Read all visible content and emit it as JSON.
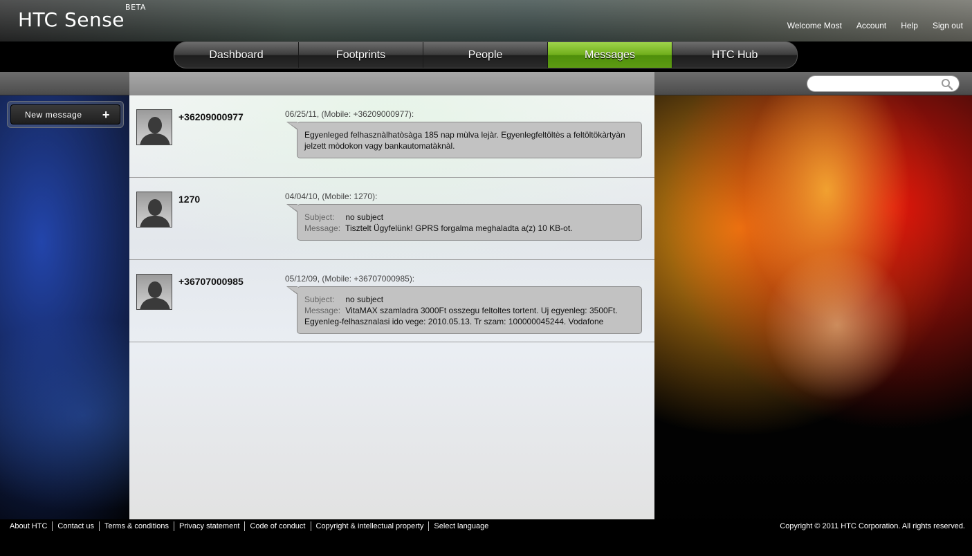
{
  "header": {
    "logo": "HTC Sense",
    "logo_sup": "BETA",
    "links": [
      "Welcome Most",
      "Account",
      "Help",
      "Sign out"
    ]
  },
  "nav": {
    "tabs": [
      {
        "label": "Dashboard",
        "active": false
      },
      {
        "label": "Footprints",
        "active": false
      },
      {
        "label": "People",
        "active": false
      },
      {
        "label": "Messages",
        "active": true
      },
      {
        "label": "HTC Hub",
        "active": false
      }
    ]
  },
  "search": {
    "placeholder": ""
  },
  "sidebar": {
    "new_message_label": "New message",
    "plus": "+"
  },
  "messages": [
    {
      "sender": "+36209000977",
      "meta": "06/25/11, (Mobile: +36209000977):",
      "body": "Egyenleged felhasznàlhatòsàga 185 nap mùlva lejàr. Egyenlegfeltöltès a feltöltökàrtyàn jelzett mòdokon vagy bankautomatàknàl."
    },
    {
      "sender": "1270",
      "meta": "04/04/10, (Mobile: 1270):",
      "subject_label": "Subject:",
      "subject": "no subject",
      "message_label": "Message:",
      "message": "Tisztelt Ügyfelünk! GPRS forgalma meghaladta a(z) 10 KB-ot."
    },
    {
      "sender": "+36707000985",
      "meta": "05/12/09, (Mobile: +36707000985):",
      "subject_label": "Subject:",
      "subject": "no subject",
      "message_label": "Message:",
      "message": "VitaMAX szamladra 3000Ft osszegu feltoltes tortent. Uj egyenleg: 3500Ft.",
      "message_cont": "Egyenleg-felhasznalasi ido vege: 2010.05.13. Tr szam: 100000045244. Vodafone"
    }
  ],
  "footer": {
    "links": [
      "About HTC",
      "Contact us",
      "Terms & conditions",
      "Privacy statement",
      "Code of conduct",
      "Copyright & intellectual property",
      "Select language"
    ],
    "copyright": "Copyright © 2011 HTC Corporation. All rights reserved."
  },
  "colors": {
    "accent": "#6fae1a",
    "bubble": "#c2c2c2"
  }
}
